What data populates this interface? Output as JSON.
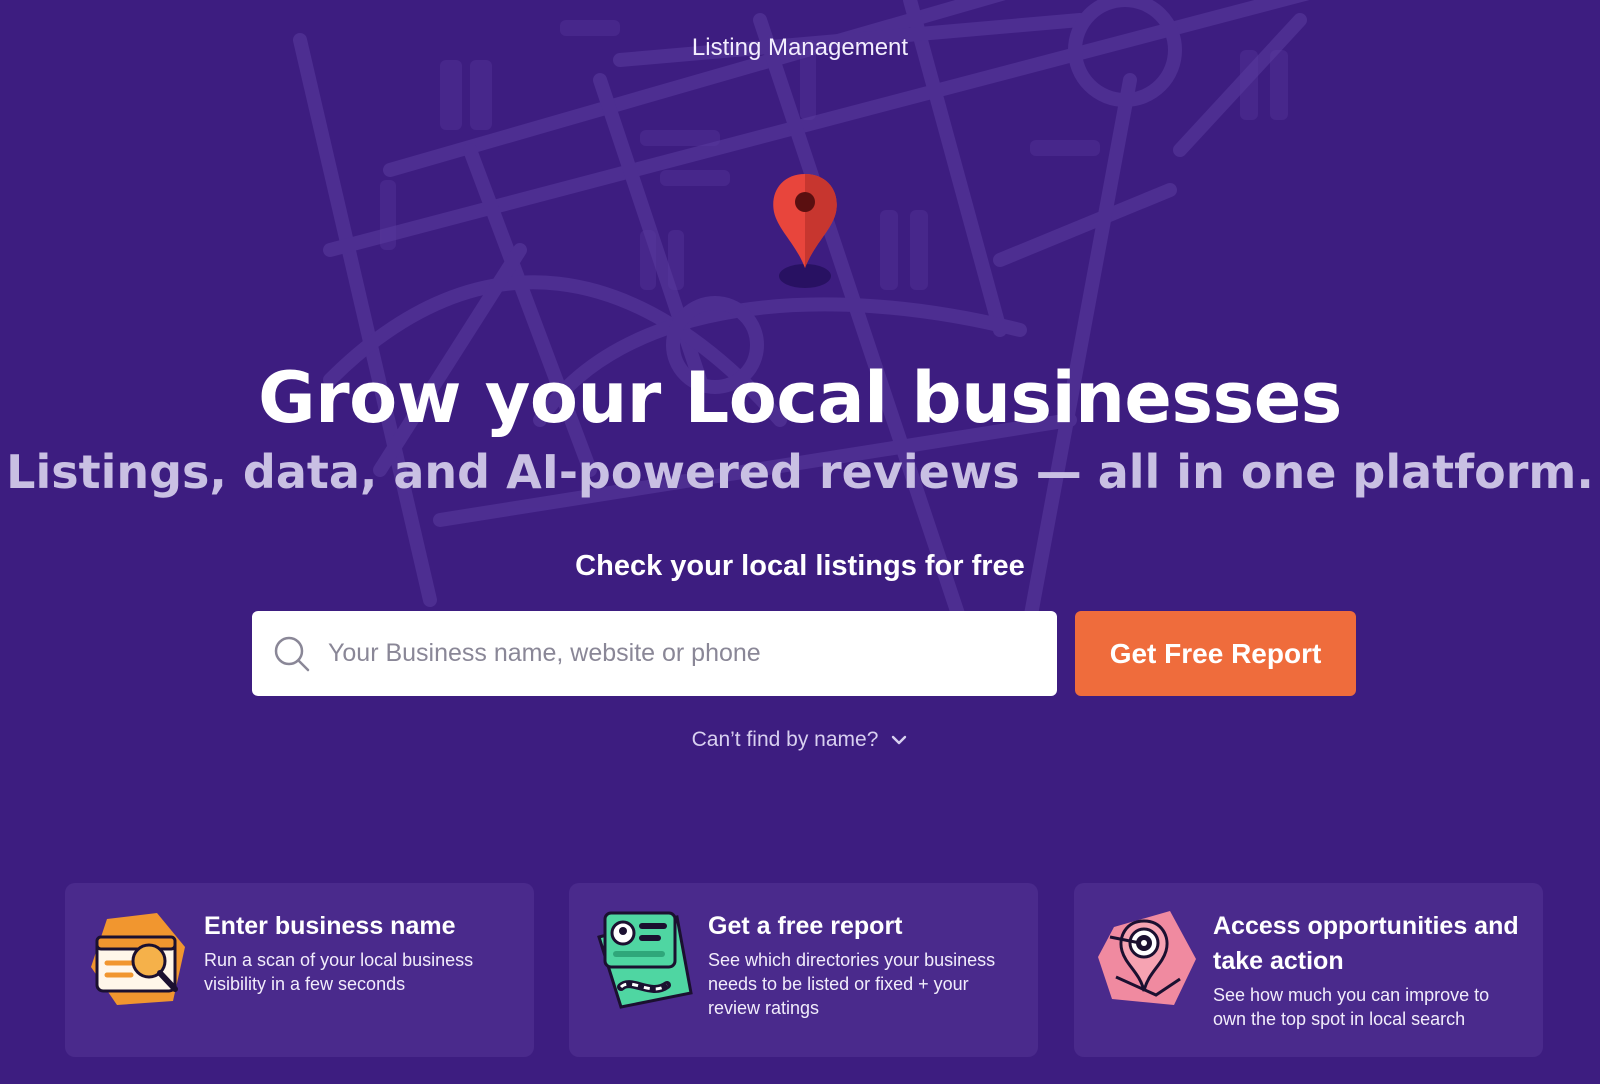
{
  "header": {
    "section_label": "Listing Management"
  },
  "hero": {
    "headline": "Grow your Local businesses",
    "subheadline": "Listings, data, and AI-powered reviews — all in one platform.",
    "cta_title": "Check your local listings for free"
  },
  "search": {
    "placeholder": "Your Business name, website or phone",
    "value": "",
    "icon": "search-icon"
  },
  "report_button": {
    "label": "Get Free Report"
  },
  "cant_find": {
    "label": "Can’t find by name?",
    "icon": "chevron-down-icon"
  },
  "steps": [
    {
      "title": "Enter business name",
      "description": "Run a scan of your local business visibility in a few seconds",
      "icon": "magnifier-browser-illustration"
    },
    {
      "title": "Get a free report",
      "description": "See which directories your business needs to be listed or fixed + your review ratings",
      "icon": "report-card-illustration"
    },
    {
      "title": "Access opportunities and take action",
      "description": "See how much you can improve to own the top spot in local search",
      "icon": "target-pin-illustration"
    }
  ],
  "colors": {
    "background": "#3d1d80",
    "accent": "#ef6c3c",
    "card": "#4a2a8c",
    "subheadline": "#c9c0e3",
    "pin": "#e8453c"
  }
}
